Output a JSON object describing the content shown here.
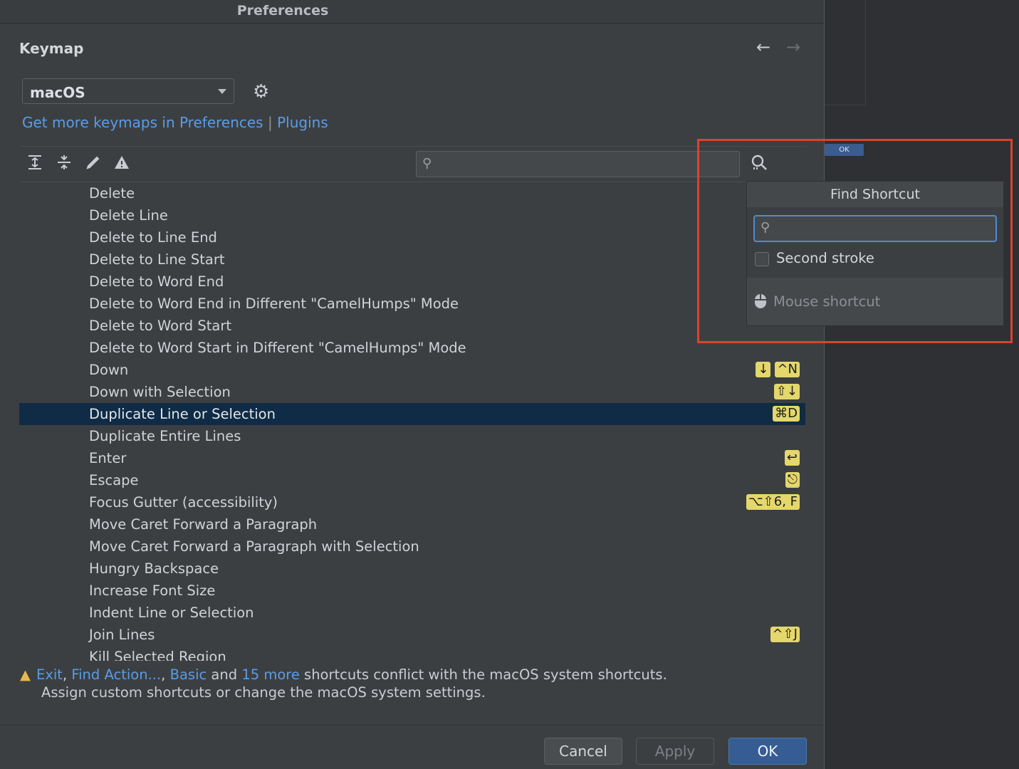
{
  "window": {
    "title": "Preferences"
  },
  "page": {
    "heading": "Keymap"
  },
  "nav": {
    "back": "←",
    "forward": "→"
  },
  "keymap": {
    "selected": "macOS",
    "link_keymaps": "Get more keymaps in Preferences",
    "link_sep": "|",
    "link_plugins": "Plugins"
  },
  "toolbar": {
    "search_placeholder": ""
  },
  "actions": [
    {
      "label": "Delete",
      "keys": []
    },
    {
      "label": "Delete Line",
      "keys": []
    },
    {
      "label": "Delete to Line End",
      "keys": []
    },
    {
      "label": "Delete to Line Start",
      "keys": []
    },
    {
      "label": "Delete to Word End",
      "keys": []
    },
    {
      "label": "Delete to Word End in Different \"CamelHumps\" Mode",
      "keys": []
    },
    {
      "label": "Delete to Word Start",
      "keys": [
        "⌥⌫"
      ]
    },
    {
      "label": "Delete to Word Start in Different \"CamelHumps\" Mode",
      "keys": []
    },
    {
      "label": "Down",
      "keys": [
        "↓",
        "^N"
      ]
    },
    {
      "label": "Down with Selection",
      "keys": [
        "⇧↓"
      ]
    },
    {
      "label": "Duplicate Line or Selection",
      "keys": [
        "⌘D"
      ]
    },
    {
      "label": "Duplicate Entire Lines",
      "keys": []
    },
    {
      "label": "Enter",
      "keys": [
        "↩"
      ]
    },
    {
      "label": "Escape",
      "keys": [
        "⎋"
      ]
    },
    {
      "label": "Focus Gutter (accessibility)",
      "keys": [
        "⌥⇧6, F"
      ]
    },
    {
      "label": "Move Caret Forward a Paragraph",
      "keys": []
    },
    {
      "label": "Move Caret Forward a Paragraph with Selection",
      "keys": []
    },
    {
      "label": "Hungry Backspace",
      "keys": []
    },
    {
      "label": "Increase Font Size",
      "keys": []
    },
    {
      "label": "Indent Line or Selection",
      "keys": []
    },
    {
      "label": "Join Lines",
      "keys": [
        "^⇧J"
      ]
    },
    {
      "label": "Kill Selected Region",
      "keys": []
    }
  ],
  "selected_index": 10,
  "warning": {
    "link1": "Exit",
    "sep1": ", ",
    "link2": "Find Action...",
    "sep2": ", ",
    "link3": "Basic",
    "and": " and ",
    "link4": "15 more",
    "text1": " shortcuts conflict with the macOS system shortcuts.",
    "text2": "Assign custom shortcuts or change the macOS system settings."
  },
  "buttons": {
    "cancel": "Cancel",
    "apply": "Apply",
    "ok": "OK"
  },
  "popup": {
    "title": "Find Shortcut",
    "search_value": "",
    "second_stroke": "Second stroke",
    "mouse_shortcut": "Mouse shortcut"
  },
  "background_window": {
    "ok": "OK"
  },
  "colors": {
    "shortcut_badge": "#e4d76b",
    "selection": "#0f2b45",
    "link": "#5a9ce8",
    "primary_button": "#365d93",
    "highlight_box": "#d9432f"
  }
}
